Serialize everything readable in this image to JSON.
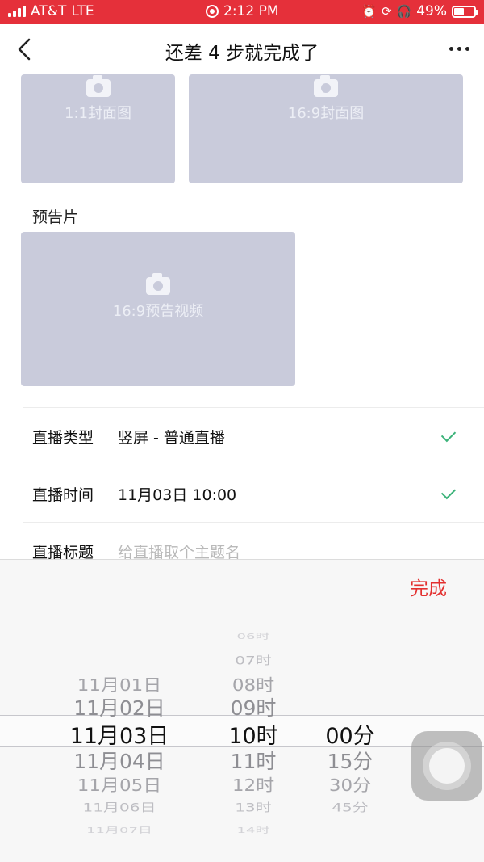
{
  "status_bar": {
    "carrier": "AT&T",
    "network": "LTE",
    "time": "2:12 PM",
    "battery_percent": "49%"
  },
  "nav": {
    "title": "还差 4 步就完成了"
  },
  "covers": {
    "square_label": "1:1封面图",
    "wide_label": "16:9封面图"
  },
  "trailer": {
    "section_label": "预告片",
    "video_label": "16:9预告视频"
  },
  "form": {
    "live_type_label": "直播类型",
    "live_type_value": "竖屏 - 普通直播",
    "live_time_label": "直播时间",
    "live_time_value": "11月03日 10:00",
    "live_title_label": "直播标题",
    "live_title_placeholder": "给直播取个主题名"
  },
  "picker": {
    "done_label": "完成",
    "dates": [
      "11月01日",
      "11月02日",
      "11月03日",
      "11月04日",
      "11月05日",
      "11月06日",
      "11月07日"
    ],
    "hours": [
      "06时",
      "07时",
      "08时",
      "09时",
      "10时",
      "11时",
      "12时",
      "13时",
      "14时"
    ],
    "minutes": [
      "00分",
      "15分",
      "30分",
      "45分"
    ],
    "selected": {
      "date": "11月03日",
      "hour": "10时",
      "minute": "00分"
    }
  },
  "colors": {
    "status_bar_bg": "#e5303a",
    "accent_red": "#e3302f",
    "check_green": "#3cb37a",
    "placeholder_bg": "#c9cbdb"
  }
}
